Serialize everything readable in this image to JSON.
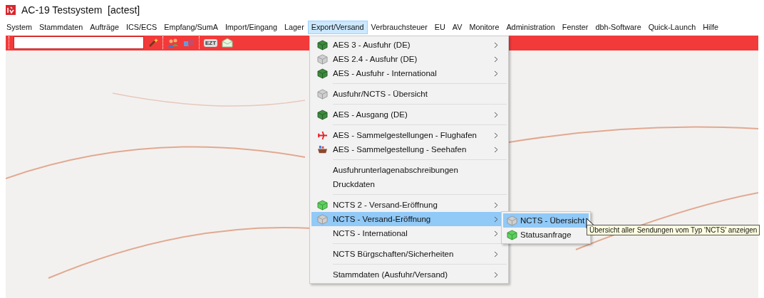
{
  "window": {
    "title": "AC-19 Testsystem  [actest]"
  },
  "menu_bar": [
    {
      "label": "System",
      "selected": false
    },
    {
      "label": "Stammdaten",
      "selected": false
    },
    {
      "label": "Aufträge",
      "selected": false
    },
    {
      "label": "ICS/ECS",
      "selected": false
    },
    {
      "label": "Empfang/SumA",
      "selected": false
    },
    {
      "label": "Import/Eingang",
      "selected": false
    },
    {
      "label": "Lager",
      "selected": false
    },
    {
      "label": "Export/Versand",
      "selected": true
    },
    {
      "label": "Verbrauchsteuer",
      "selected": false
    },
    {
      "label": "EU",
      "selected": false
    },
    {
      "label": "AV",
      "selected": false
    },
    {
      "label": "Monitore",
      "selected": false
    },
    {
      "label": "Administration",
      "selected": false
    },
    {
      "label": "Fenster",
      "selected": false
    },
    {
      "label": "dbh-Software",
      "selected": false
    },
    {
      "label": "Quick-Launch",
      "selected": false
    },
    {
      "label": "Hilfe",
      "selected": false
    }
  ],
  "toolbar": {
    "badge": "EZT"
  },
  "menu": [
    {
      "kind": "module",
      "label": "AES 3 - Ausfuhr (DE)",
      "submenu": true,
      "selected": false
    },
    {
      "kind": "inactive",
      "label": "AES 2.4 - Ausfuhr (DE)",
      "submenu": true,
      "selected": false
    },
    {
      "kind": "module",
      "label": "AES - Ausfuhr - International",
      "submenu": true,
      "selected": false
    },
    {
      "kind": "separator"
    },
    {
      "kind": "inactive",
      "label": "Ausfuhr/NCTS - Übersicht",
      "submenu": false,
      "selected": false
    },
    {
      "kind": "separator"
    },
    {
      "kind": "module",
      "label": "AES - Ausgang (DE)",
      "submenu": true,
      "selected": false
    },
    {
      "kind": "separator"
    },
    {
      "kind": "airport",
      "label": "AES - Sammelgestellungen - Flughafen",
      "submenu": true,
      "selected": false
    },
    {
      "kind": "seaport",
      "label": "AES - Sammelgestellung - Seehafen",
      "submenu": true,
      "selected": false
    },
    {
      "kind": "separator"
    },
    {
      "kind": "plain",
      "label": "Ausfuhrunterlagenabschreibungen",
      "submenu": false,
      "selected": false
    },
    {
      "kind": "plain",
      "label": "Druckdaten",
      "submenu": false,
      "selected": false
    },
    {
      "kind": "separator"
    },
    {
      "kind": "light",
      "label": "NCTS 2 - Versand-Eröffnung",
      "submenu": true,
      "selected": false
    },
    {
      "kind": "inactive",
      "label": "NCTS - Versand-Eröffnung",
      "submenu": true,
      "selected": true
    },
    {
      "kind": "plain",
      "label": "NCTS - International",
      "submenu": true,
      "selected": false
    },
    {
      "kind": "separator"
    },
    {
      "kind": "plain",
      "label": "NCTS Bürgschaften/Sicherheiten",
      "submenu": true,
      "selected": false
    },
    {
      "kind": "separator"
    },
    {
      "kind": "plain",
      "label": "Stammdaten (Ausfuhr/Versand)",
      "submenu": true,
      "selected": false
    }
  ],
  "submenu": [
    {
      "kind": "inactive",
      "label": "NCTS - Übersicht",
      "selected": true
    },
    {
      "kind": "light",
      "label": "Statusanfrage",
      "selected": false
    }
  ],
  "tooltip": "Übersicht aller Sendungen vom Typ 'NCTS' anzeigen"
}
